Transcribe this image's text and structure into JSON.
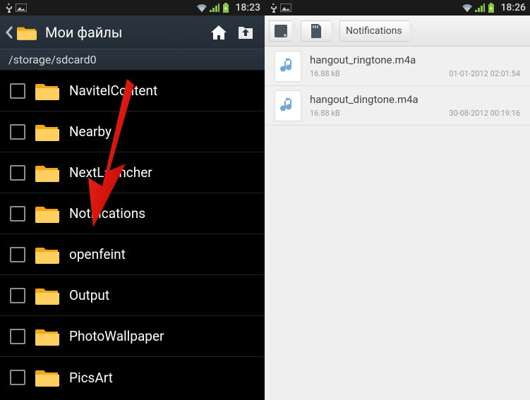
{
  "left": {
    "status": {
      "time": "18:23"
    },
    "header": {
      "title": "Мои файлы"
    },
    "path": "/storage/sdcard0",
    "items": [
      {
        "label": "NavitelContent"
      },
      {
        "label": "Nearby"
      },
      {
        "label": "NextLauncher"
      },
      {
        "label": "Notifications"
      },
      {
        "label": "openfeint"
      },
      {
        "label": "Output"
      },
      {
        "label": "PhotoWallpaper"
      },
      {
        "label": "PicsArt"
      }
    ]
  },
  "right": {
    "status": {
      "time": "18:26"
    },
    "breadcrumb": "Notifications",
    "files": [
      {
        "name": "hangout_ringtone.m4a",
        "size": "16.88 kB",
        "date": "01-01-2012 02:01:54"
      },
      {
        "name": "hangout_dingtone.m4a",
        "size": "16.88 kB",
        "date": "30-08-2012 00:19:16"
      }
    ]
  }
}
